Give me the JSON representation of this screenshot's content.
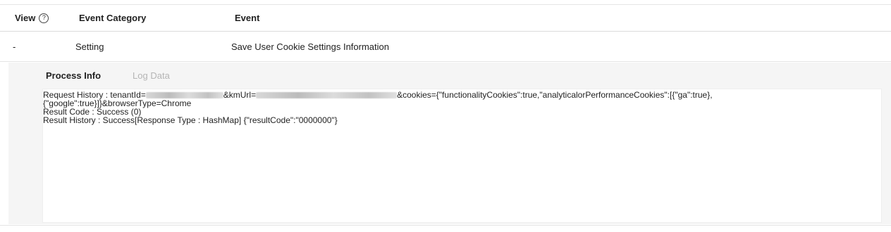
{
  "table": {
    "headers": {
      "view": "View",
      "category": "Event Category",
      "event": "Event"
    },
    "help_icon_glyph": "?",
    "row": {
      "view": "-",
      "category": "Setting",
      "event": "Save User Cookie Settings Information"
    }
  },
  "detail": {
    "tabs": [
      {
        "label": "Process Info",
        "active": true
      },
      {
        "label": "Log Data",
        "active": false
      }
    ],
    "request": {
      "prefix": "Request History : tenantId=",
      "kmurl_label": "&kmUrl=",
      "cookies_text": "&cookies={\"functionalityCookies\":true,\"analyticalorPerformanceCookies\":[{\"ga\":true},",
      "line2": "{\"google\":true}]}&browserType=Chrome"
    },
    "result_code": "Result Code : Success (0)",
    "result_history": "Result History : Success[Response Type : HashMap] {\"resultCode\":\"0000000\"}"
  },
  "colors": {
    "detail_background": "#f5f5f5",
    "inactive_tab": "#b5b5b5",
    "border": "#e4e4e4"
  }
}
